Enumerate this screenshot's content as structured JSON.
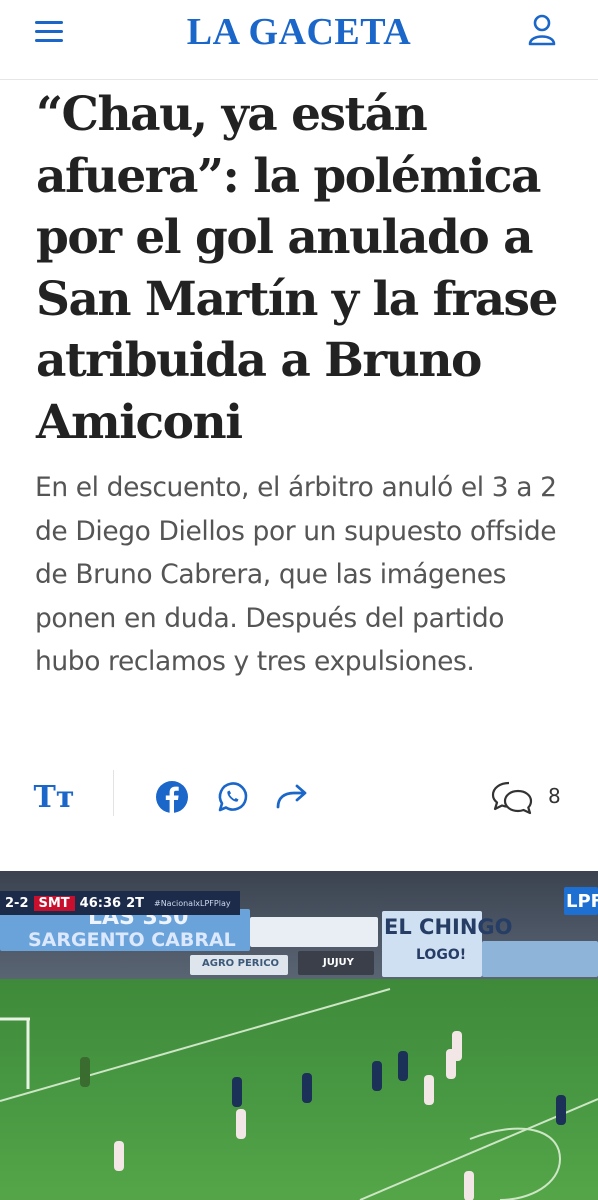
{
  "header": {
    "logo_text": "LA GACETA",
    "menu_icon": "hamburger-menu-icon",
    "user_icon": "user-account-icon",
    "brand_color": "#1a66c9"
  },
  "article": {
    "headline": "“Chau, ya están afuera”: la polémica por el gol anulado a San Martín y la frase atribuida a Bruno Amiconi",
    "summary": "En el descuento, el árbitro anuló el 3 a 2 de Diego Diellos por un supuesto offside de Bruno Cabrera, que las imágenes ponen en duda. Después del partido hubo reclamos y tres expulsiones."
  },
  "actions": {
    "text_size_label": "Tт",
    "facebook_icon": "facebook-icon",
    "whatsapp_icon": "whatsapp-icon",
    "share_icon": "share-arrow-icon",
    "comments_icon": "comments-icon",
    "comment_count": "8"
  },
  "hero_image": {
    "score": "2-2",
    "team": "SMT",
    "clock": "46:36",
    "period": "2T",
    "hashtag": "#NacionalxLPFPlay",
    "boards": [
      "LAS 330",
      "SARGENTO CABRAL",
      "AGRO PERICO",
      "JUJUY",
      "EL CHINGO",
      "LOGO!",
      "LPF"
    ]
  }
}
